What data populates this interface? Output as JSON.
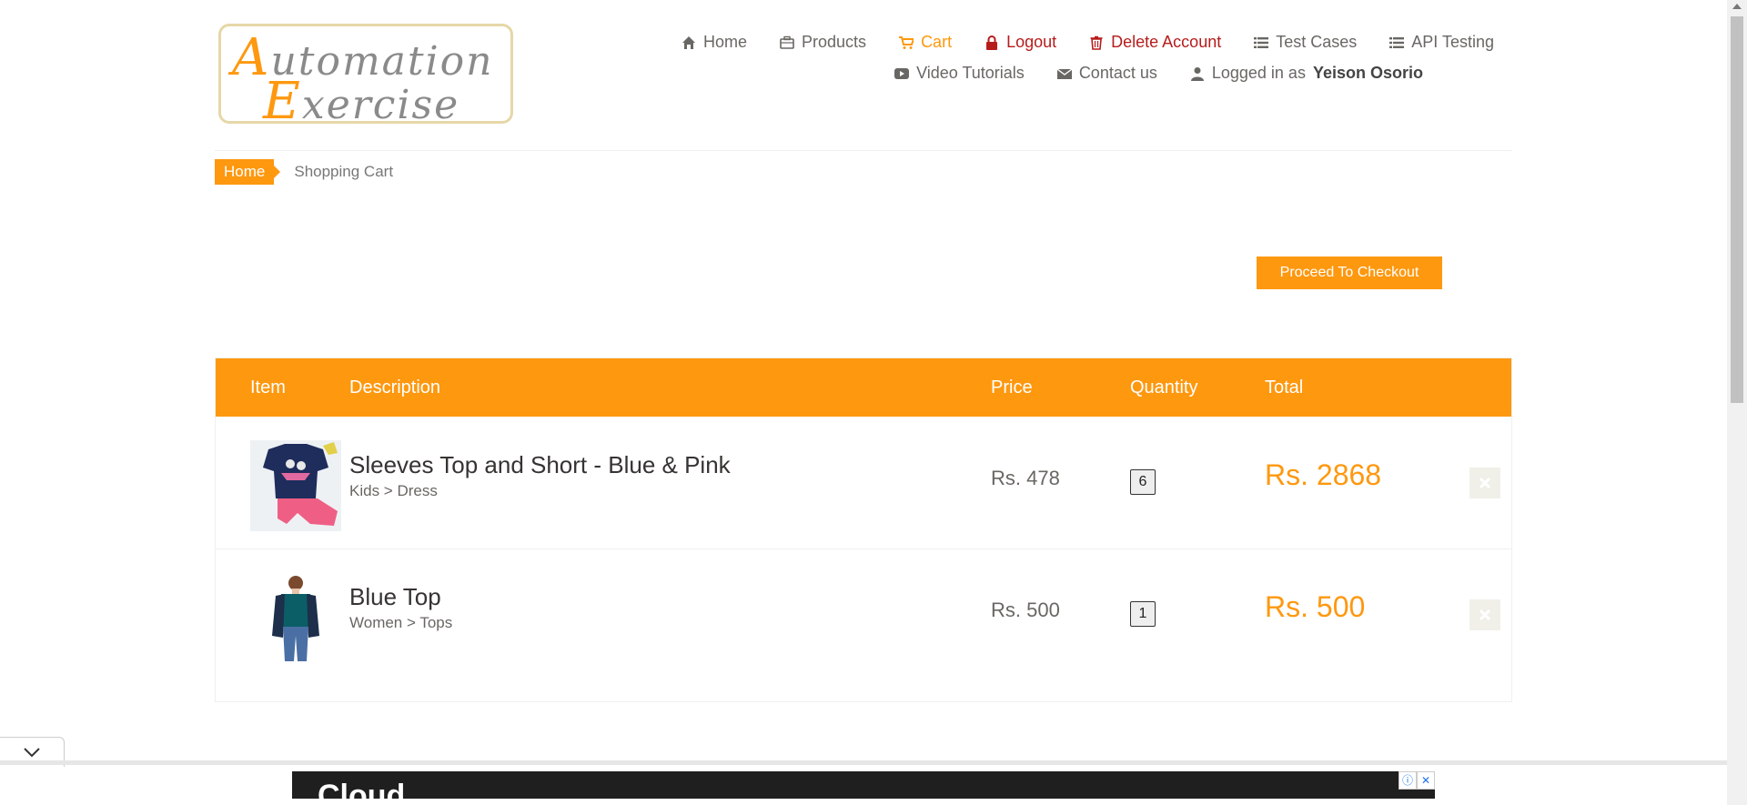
{
  "logo": {
    "line1_big": "A",
    "line1_rest": "utomation",
    "line2_big": "E",
    "line2_rest": "xercise"
  },
  "nav": {
    "home": "Home",
    "products": "Products",
    "cart": "Cart",
    "logout": "Logout",
    "delete_account": "Delete Account",
    "test_cases": "Test Cases",
    "api_testing": "API Testing",
    "video_tutorials": "Video Tutorials",
    "contact_us": "Contact us",
    "logged_in_prefix": "Logged in as",
    "user_name": "Yeison Osorio"
  },
  "breadcrumb": {
    "home": "Home",
    "current": "Shopping Cart"
  },
  "checkout_button": "Proceed To Checkout",
  "cart": {
    "headers": [
      "Item",
      "Description",
      "Price",
      "Quantity",
      "Total"
    ],
    "items": [
      {
        "name": "Sleeves Top and Short - Blue & Pink",
        "category": "Kids > Dress",
        "price": "Rs. 478",
        "quantity": "6",
        "total": "Rs. 2868"
      },
      {
        "name": "Blue Top",
        "category": "Women > Tops",
        "price": "Rs. 500",
        "quantity": "1",
        "total": "Rs. 500"
      }
    ]
  },
  "ad": {
    "text": "Cloud"
  },
  "colors": {
    "accent": "#fe980f",
    "danger": "#b71c1c",
    "text": "#696763"
  }
}
